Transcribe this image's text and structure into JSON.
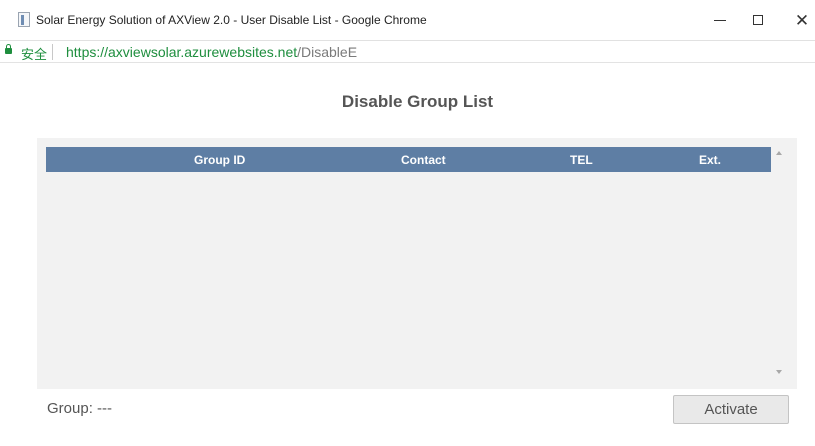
{
  "window": {
    "title": "Solar Energy Solution of AXView 2.0 - User Disable List - Google Chrome",
    "minimize_label": "—",
    "maximize_label": "☐",
    "close_label": "✕"
  },
  "addressbar": {
    "secure_label": "安全",
    "url_host": "https://axviewsolar.azurewebsites.net",
    "url_path": "/DisableE"
  },
  "page": {
    "title": "Disable Group List"
  },
  "grid": {
    "columns": [
      "Group ID",
      "Contact",
      "TEL",
      "Ext."
    ],
    "rows": []
  },
  "footer": {
    "group_label": "Group: ---",
    "activate_label": "Activate"
  }
}
